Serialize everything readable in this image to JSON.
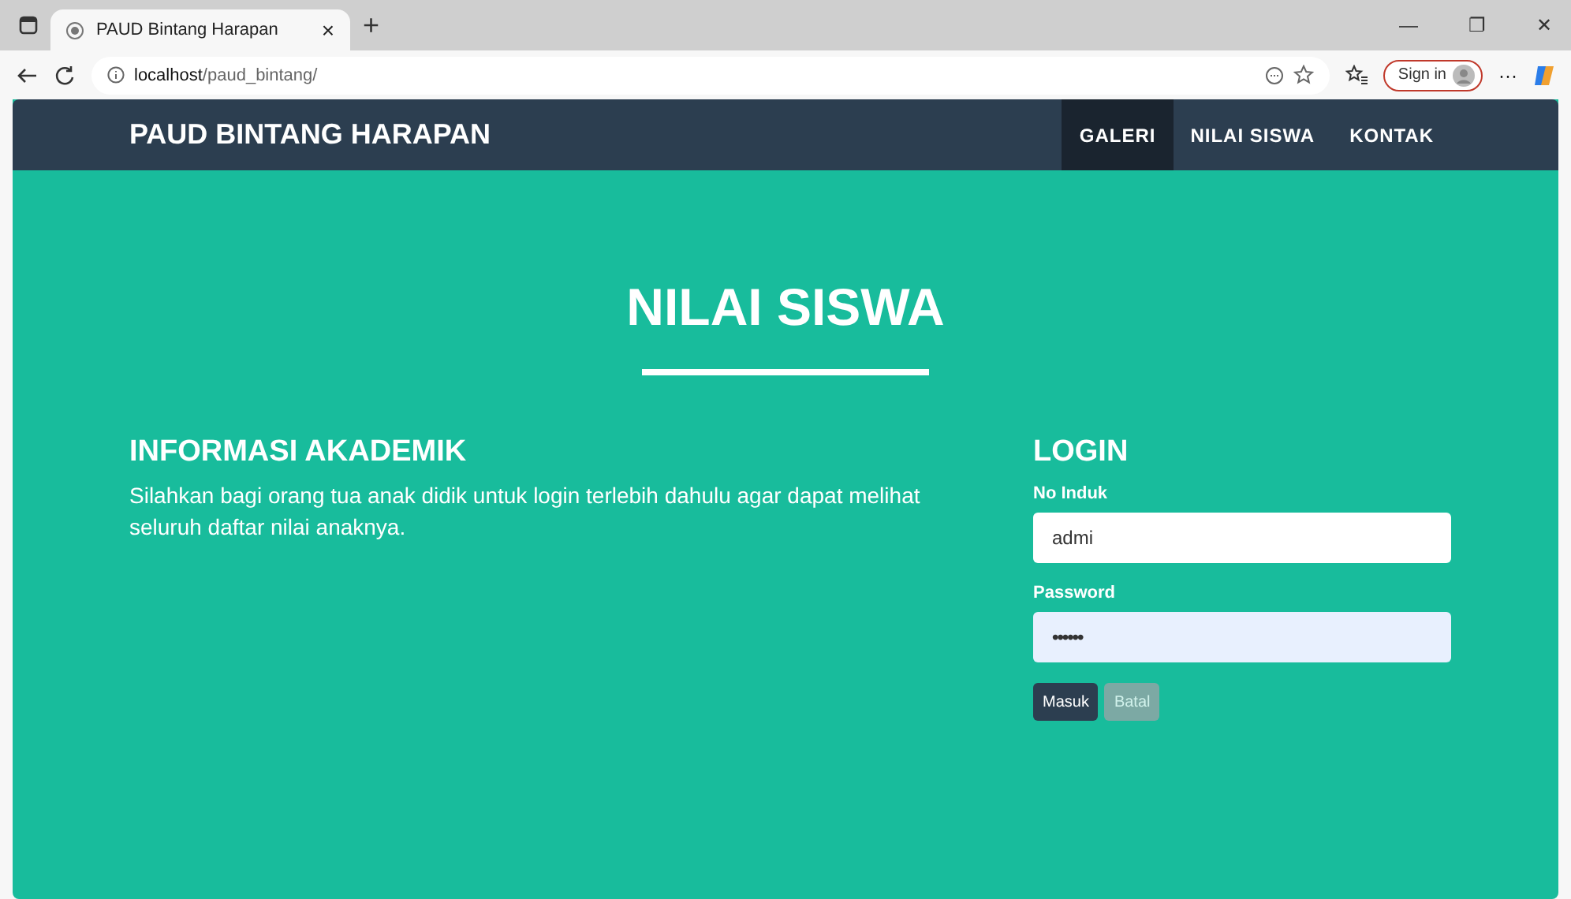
{
  "browser": {
    "tab_title": "PAUD Bintang Harapan",
    "tab_close": "×",
    "new_tab": "+",
    "address_host": "localhost",
    "address_path": "/paud_bintang/",
    "sign_in": "Sign in",
    "more": "···",
    "window_controls": [
      "—",
      "❐",
      "✕"
    ]
  },
  "navbar": {
    "brand": "PAUD BINTANG HARAPAN",
    "links": [
      {
        "label": "GALERI",
        "selected": true
      },
      {
        "label": "NILAI SISWA",
        "selected": false
      },
      {
        "label": "KONTAK",
        "selected": false
      }
    ]
  },
  "hero": {
    "title": "NILAI SISWA"
  },
  "info": {
    "heading": "INFORMASI AKADEMIK",
    "text": "Silahkan bagi orang tua anak didik untuk login terlebih dahulu agar dapat melihat seluruh daftar nilai anaknya."
  },
  "login": {
    "heading": "LOGIN",
    "fields": [
      {
        "label": "No Induk",
        "value": "admi",
        "kind": "text",
        "autofilled": false
      },
      {
        "label": "Password",
        "value": "••••••",
        "kind": "password",
        "autofilled": true
      }
    ],
    "buttons": [
      {
        "label": "Masuk",
        "kind": "primary"
      },
      {
        "label": "Batal",
        "kind": "secondary"
      }
    ]
  }
}
